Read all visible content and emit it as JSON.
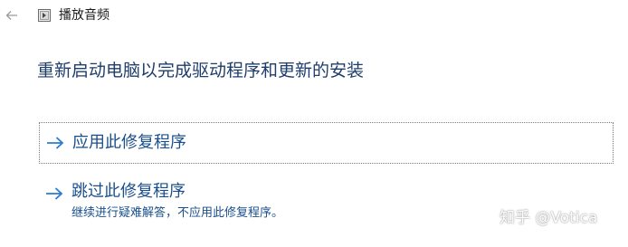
{
  "titlebar": {
    "title": "播放音频",
    "back_icon": "back-arrow-icon",
    "app_icon": "troubleshooter-icon"
  },
  "main": {
    "heading": "重新启动电脑以完成驱动程序和更新的安装",
    "options": [
      {
        "label": "应用此修复程序",
        "icon": "arrow-right-icon",
        "focused": true
      },
      {
        "label": "跳过此修复程序",
        "description": "继续进行疑难解答，不应用此修复程序。",
        "icon": "arrow-right-icon",
        "focused": false
      }
    ]
  },
  "watermark": {
    "text": "知乎 @Votica"
  },
  "colors": {
    "heading": "#1e3d6b",
    "link": "#1a4f8c",
    "arrow": "#2b7bd0"
  }
}
